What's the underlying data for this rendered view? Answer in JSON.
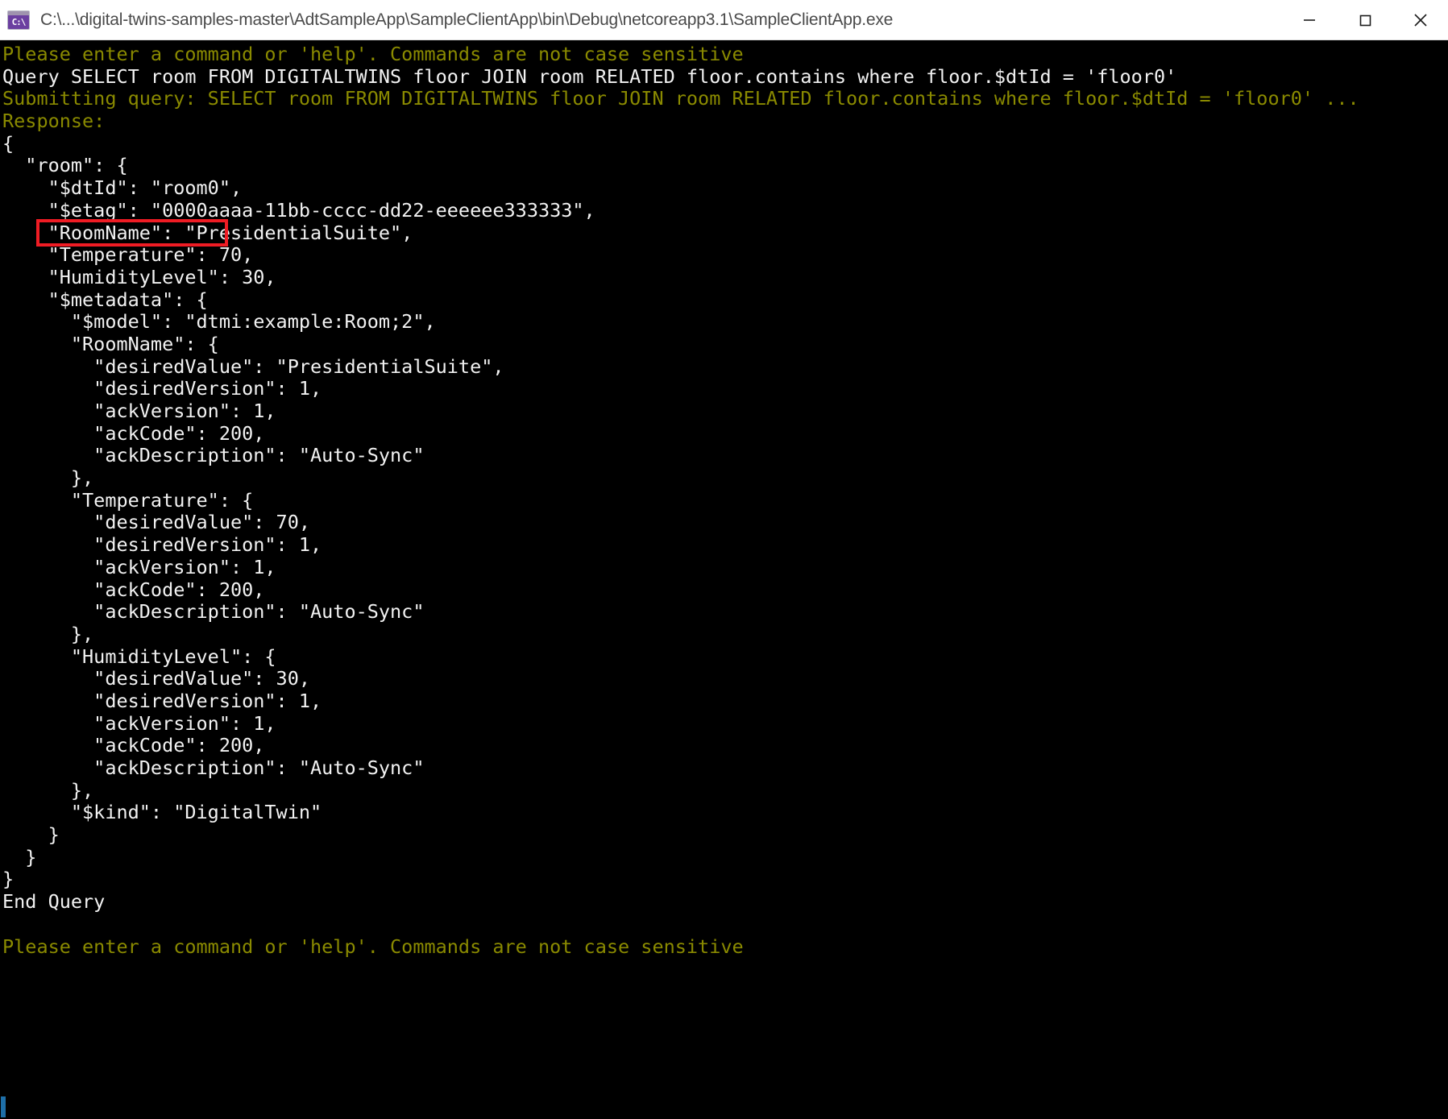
{
  "window": {
    "title": "C:\\...\\digital-twins-samples-master\\AdtSampleApp\\SampleClientApp\\bin\\Debug\\netcoreapp3.1\\SampleClientApp.exe",
    "icon_label": "C:\\",
    "minimize_label": "Minimize",
    "maximize_label": "Maximize",
    "close_label": "Close"
  },
  "colors": {
    "background": "#000000",
    "prompt_text": "#8a8a00",
    "output_text": "#f2f2f2",
    "highlight_border": "#ef1c24",
    "titlebar_background": "#ffffff",
    "icon_background": "#6b3fa0",
    "caret": "#1e6fa8"
  },
  "highlight": {
    "target_text": "\"$dtId\": \"room0\",",
    "description": "red-rectangle-annotation"
  },
  "console": {
    "lines": [
      {
        "text": "Please enter a command or 'help'. Commands are not case sensitive",
        "color": "olive"
      },
      {
        "text": "Query SELECT room FROM DIGITALTWINS floor JOIN room RELATED floor.contains where floor.$dtId = 'floor0'",
        "color": "white"
      },
      {
        "text": "Submitting query: SELECT room FROM DIGITALTWINS floor JOIN room RELATED floor.contains where floor.$dtId = 'floor0' ...",
        "color": "olive"
      },
      {
        "text": "Response:",
        "color": "olive"
      },
      {
        "text": "{",
        "color": "white"
      },
      {
        "text": "  \"room\": {",
        "color": "white"
      },
      {
        "text": "    \"$dtId\": \"room0\",",
        "color": "white"
      },
      {
        "text": "    \"$etag\": \"0000aaaa-11bb-cccc-dd22-eeeeee333333\",",
        "color": "white"
      },
      {
        "text": "    \"RoomName\": \"PresidentialSuite\",",
        "color": "white"
      },
      {
        "text": "    \"Temperature\": 70,",
        "color": "white"
      },
      {
        "text": "    \"HumidityLevel\": 30,",
        "color": "white"
      },
      {
        "text": "    \"$metadata\": {",
        "color": "white"
      },
      {
        "text": "      \"$model\": \"dtmi:example:Room;2\",",
        "color": "white"
      },
      {
        "text": "      \"RoomName\": {",
        "color": "white"
      },
      {
        "text": "        \"desiredValue\": \"PresidentialSuite\",",
        "color": "white"
      },
      {
        "text": "        \"desiredVersion\": 1,",
        "color": "white"
      },
      {
        "text": "        \"ackVersion\": 1,",
        "color": "white"
      },
      {
        "text": "        \"ackCode\": 200,",
        "color": "white"
      },
      {
        "text": "        \"ackDescription\": \"Auto-Sync\"",
        "color": "white"
      },
      {
        "text": "      },",
        "color": "white"
      },
      {
        "text": "      \"Temperature\": {",
        "color": "white"
      },
      {
        "text": "        \"desiredValue\": 70,",
        "color": "white"
      },
      {
        "text": "        \"desiredVersion\": 1,",
        "color": "white"
      },
      {
        "text": "        \"ackVersion\": 1,",
        "color": "white"
      },
      {
        "text": "        \"ackCode\": 200,",
        "color": "white"
      },
      {
        "text": "        \"ackDescription\": \"Auto-Sync\"",
        "color": "white"
      },
      {
        "text": "      },",
        "color": "white"
      },
      {
        "text": "      \"HumidityLevel\": {",
        "color": "white"
      },
      {
        "text": "        \"desiredValue\": 30,",
        "color": "white"
      },
      {
        "text": "        \"desiredVersion\": 1,",
        "color": "white"
      },
      {
        "text": "        \"ackVersion\": 1,",
        "color": "white"
      },
      {
        "text": "        \"ackCode\": 200,",
        "color": "white"
      },
      {
        "text": "        \"ackDescription\": \"Auto-Sync\"",
        "color": "white"
      },
      {
        "text": "      },",
        "color": "white"
      },
      {
        "text": "      \"$kind\": \"DigitalTwin\"",
        "color": "white"
      },
      {
        "text": "    }",
        "color": "white"
      },
      {
        "text": "  }",
        "color": "white"
      },
      {
        "text": "}",
        "color": "white"
      },
      {
        "text": "End Query",
        "color": "white"
      },
      {
        "text": "",
        "color": "white"
      },
      {
        "text": "Please enter a command or 'help'. Commands are not case sensitive",
        "color": "olive"
      },
      {
        "text": "",
        "color": "white"
      }
    ]
  }
}
